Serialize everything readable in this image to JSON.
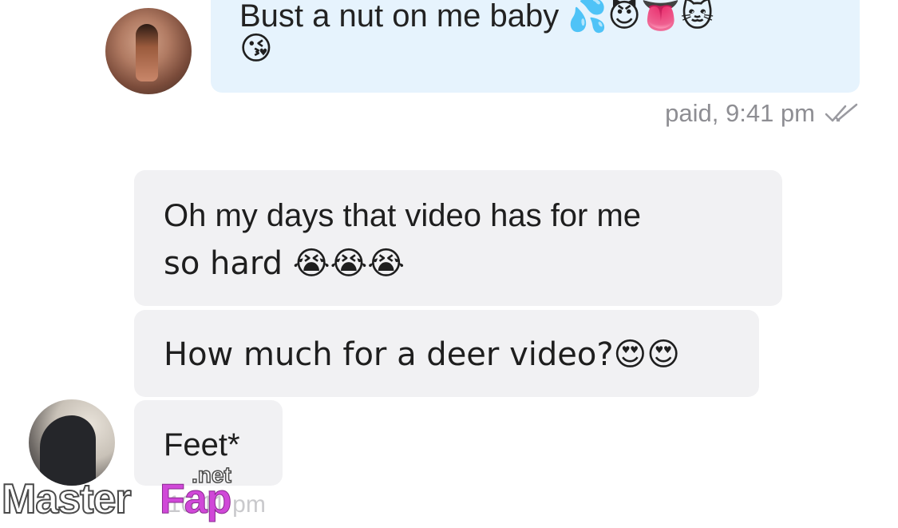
{
  "messages": [
    {
      "direction": "sent",
      "text": "Bust a nut on me baby",
      "emojis_line1": "💦😈👅🐱",
      "emojis_line2": "😘",
      "status": "paid, 9:41 pm",
      "read": true
    },
    {
      "direction": "received",
      "line1": "Oh my days that video has for me",
      "line2": "so hard 😭😭😭"
    },
    {
      "direction": "received",
      "text": "How much for a deer video?😍😍"
    },
    {
      "direction": "received",
      "text": "Feet*",
      "time_partial": "10:11 pm"
    }
  ],
  "avatars": {
    "sender": "avatar-photo",
    "receiver": "avatar-photo"
  },
  "icons": {
    "read_receipt": "double-check-icon"
  },
  "watermark": {
    "brand_left": "Master",
    "brand_right": "Fap",
    "suffix": ".net"
  },
  "colors": {
    "sent_bubble": "#e6f3fd",
    "received_bubble": "#f1f1f3",
    "meta_text": "#8e8e93",
    "watermark_accent": "#d048d8"
  }
}
